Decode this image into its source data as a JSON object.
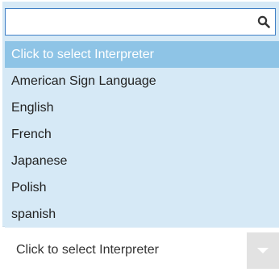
{
  "search": {
    "value": "",
    "placeholder": ""
  },
  "dropdown": {
    "options": [
      {
        "label": "Click to select Interpreter",
        "selected": true
      },
      {
        "label": "American Sign Language",
        "selected": false
      },
      {
        "label": "English",
        "selected": false
      },
      {
        "label": "French",
        "selected": false
      },
      {
        "label": "Japanese",
        "selected": false
      },
      {
        "label": "Polish",
        "selected": false
      },
      {
        "label": "spanish",
        "selected": false
      }
    ]
  },
  "select": {
    "value": "Click to select Interpreter"
  },
  "colors": {
    "panel_bg": "#d6e9f6",
    "selected_bg": "#8ec4e6",
    "focus_border": "#3f7fc6",
    "arrow_bg": "#e2e2e2"
  },
  "icons": {
    "search": "search-icon",
    "chevron": "chevron-down-icon"
  }
}
